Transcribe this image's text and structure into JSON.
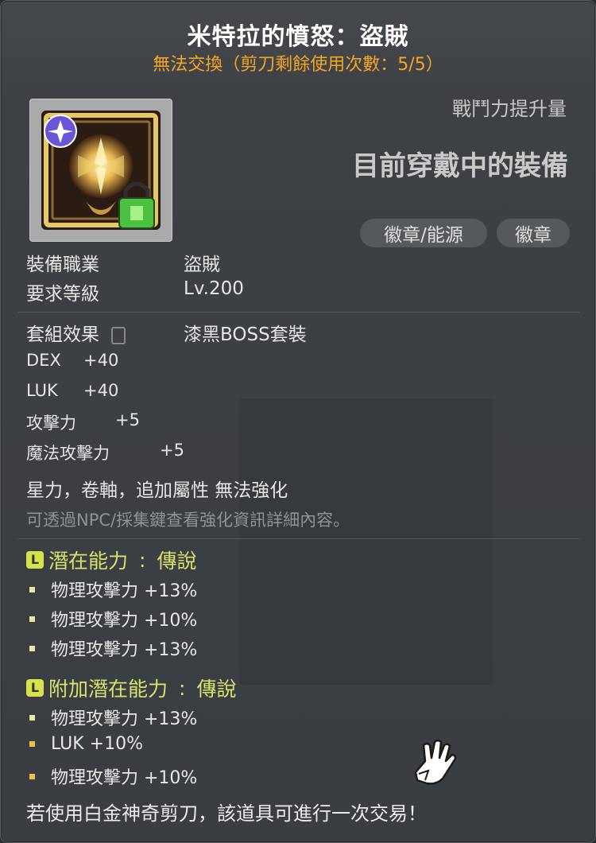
{
  "item": {
    "name": "米特拉的憤怒：盜賊",
    "trade_note": "無法交換（剪刀剩餘使用次數：5/5）"
  },
  "header": {
    "stat_increase_label": "戰鬥力提升量",
    "equipped_label": "目前穿戴中的裝備",
    "tags": [
      "徽章/能源",
      "徽章"
    ]
  },
  "requirements": {
    "job_label": "裝備職業",
    "job_value": "盜賊",
    "level_label": "要求等級",
    "level_value": "Lv.200"
  },
  "set_effect": {
    "label": "套組效果",
    "value": "漆黑BOSS套裝"
  },
  "stats": [
    {
      "name": "DEX",
      "value": "+40"
    },
    {
      "name": "LUK",
      "value": "+40"
    },
    {
      "name": "攻擊力",
      "value": "+5"
    },
    {
      "name": "魔法攻擊力",
      "value": "+5"
    }
  ],
  "enhance_note": "星力，卷軸，追加屬性 無法強化",
  "npc_note": "可透過NPC/採集鍵查看強化資訊詳細內容。",
  "potential": {
    "title": "潛在能力",
    "grade": "傳說",
    "badge": "L",
    "lines": [
      "物理攻擊力 +13%",
      "物理攻擊力 +10%",
      "物理攻擊力 +13%"
    ]
  },
  "bonus_potential": {
    "title": "附加潛在能力",
    "grade": "傳說",
    "badge": "L",
    "lines": [
      "物理攻擊力 +13%",
      "LUK +10%",
      "物理攻擊力 +10%"
    ]
  },
  "footer": "若使用白金神奇剪刀，該道具可進行一次交易！",
  "colors": {
    "title": "#ffffff",
    "trade_note": "#f5a623",
    "potential": "#d7e36a"
  }
}
